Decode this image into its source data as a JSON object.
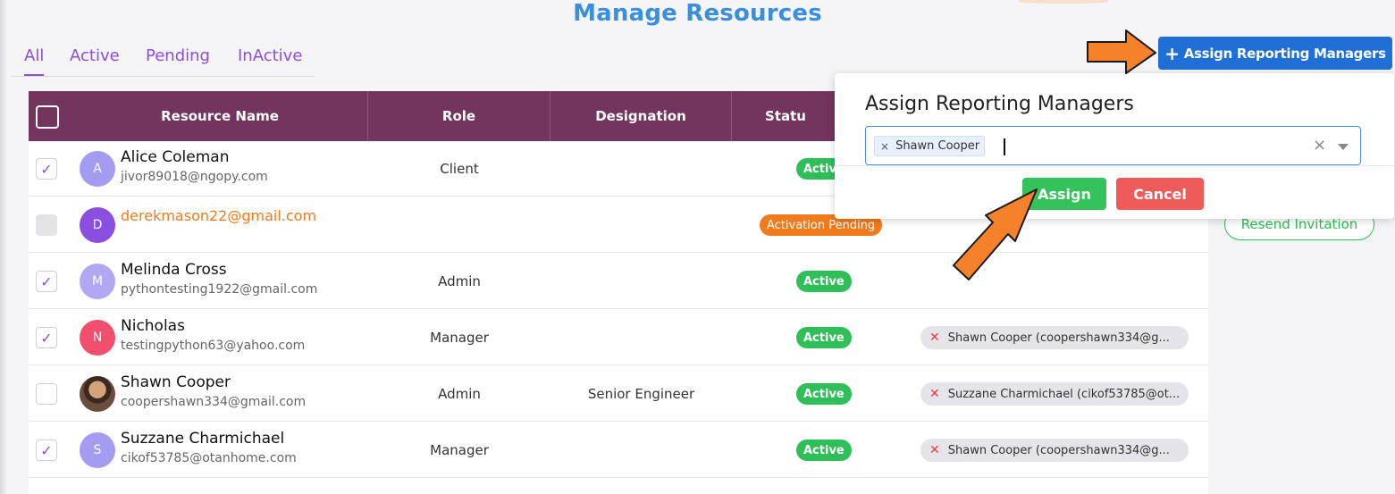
{
  "page": {
    "title": "Manage Resources"
  },
  "tabs": [
    {
      "label": "All",
      "active": true
    },
    {
      "label": "Active",
      "active": false
    },
    {
      "label": "Pending",
      "active": false
    },
    {
      "label": "InActive",
      "active": false
    }
  ],
  "toolbar": {
    "assign_managers_label": "Assign Reporting Managers",
    "plus": "+"
  },
  "table": {
    "headers": [
      "Resource Name",
      "Role",
      "Designation",
      "Statu"
    ],
    "rows": [
      {
        "checked": true,
        "initial": "A",
        "name": "Alice Coleman",
        "email": "jivor89018@ngopy.com",
        "role": "Client",
        "designation": "",
        "status": "Active",
        "manager": ""
      },
      {
        "checked": false,
        "disabled": true,
        "initial": "D",
        "name": "",
        "email": "derekmason22@gmail.com",
        "role": "",
        "designation": "",
        "status": "Activation Pending",
        "manager": "",
        "action": "Resend Invitation"
      },
      {
        "checked": true,
        "initial": "M",
        "name": "Melinda Cross",
        "email": "pythontesting1922@gmail.com",
        "role": "Admin",
        "designation": "",
        "status": "Active",
        "manager": ""
      },
      {
        "checked": true,
        "initial": "N",
        "name": "Nicholas",
        "email": "testingpython63@yahoo.com",
        "role": "Manager",
        "designation": "",
        "status": "Active",
        "manager": "Shawn Cooper (coopershawn334@g..."
      },
      {
        "checked": false,
        "initial": "",
        "name": "Shawn Cooper",
        "email": "coopershawn334@gmail.com",
        "role": "Admin",
        "designation": "Senior Engineer",
        "status": "Active",
        "manager": "Suzzane Charmichael (cikof53785@ot..."
      },
      {
        "checked": true,
        "initial": "S",
        "name": "Suzzane Charmichael",
        "email": "cikof53785@otanhome.com",
        "role": "Manager",
        "designation": "",
        "status": "Active",
        "manager": "Shawn Cooper (coopershawn334@g..."
      }
    ]
  },
  "modal": {
    "title": "Assign Reporting Managers",
    "selected": [
      "Shawn Cooper"
    ],
    "tag_remove": "×",
    "clear": "×",
    "assign_label": "Assign",
    "cancel_label": "Cancel"
  },
  "colors": {
    "header_bg": "#73355d",
    "accent_purple": "#8a4fe0",
    "primary_blue": "#1f6fd6",
    "title_blue": "#3a8fdc",
    "active_green": "#2fbf58",
    "pending_orange": "#f07b1c",
    "cancel_red": "#ef5a5a",
    "arrow_orange": "#f5822a"
  },
  "icons": [
    "plus-icon",
    "check-icon",
    "close-icon",
    "chevron-down-icon",
    "arrow-pointer-icon"
  ]
}
